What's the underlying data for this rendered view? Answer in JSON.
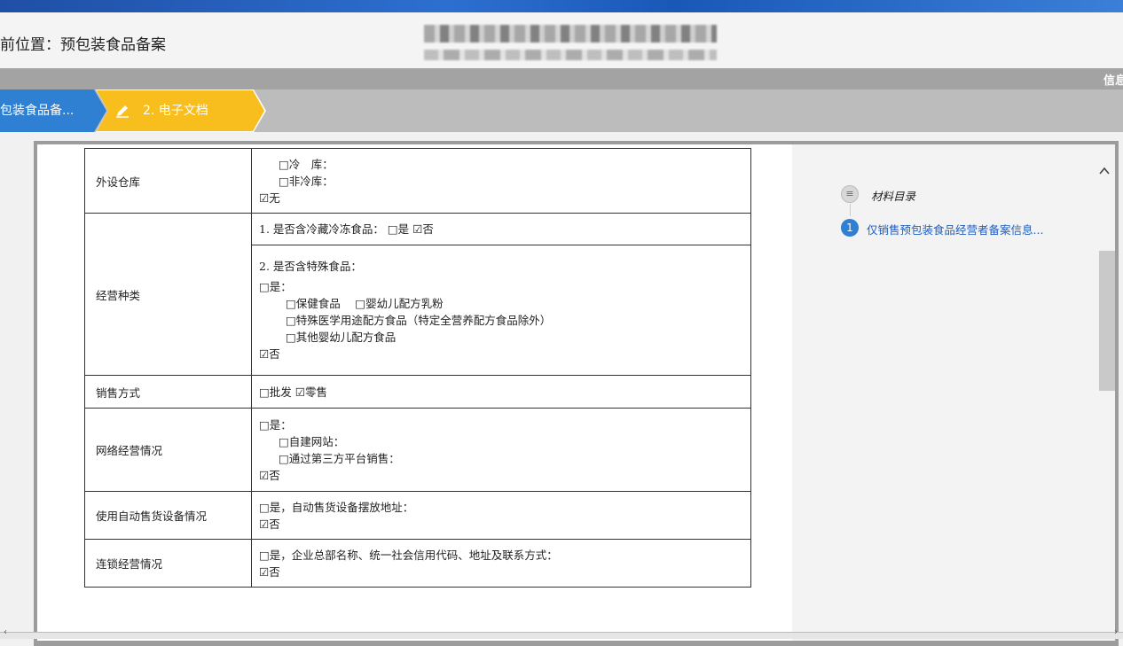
{
  "header": {
    "location": "前位置：预包装食品备案",
    "info_label": "信息"
  },
  "steps": [
    {
      "label": "包装食品备..."
    },
    {
      "label": "2. 电子文档",
      "icon": "pencil-icon"
    }
  ],
  "form": {
    "rows": [
      {
        "label": "外设仓库",
        "lines": [
          "□冷　库：",
          "□非冷库：",
          "☑无"
        ]
      },
      {
        "label": "经营种类",
        "sub1": "1. 是否含冷藏冷冻食品：  □是 ☑否",
        "sub2": [
          "2. 是否含特殊食品：",
          "□是：",
          "□保健食品　 □婴幼儿配方乳粉",
          "□特殊医学用途配方食品（特定全营养配方食品除外）",
          "□其他婴幼儿配方食品",
          "☑否"
        ]
      },
      {
        "label": "销售方式",
        "lines": [
          "□批发 ☑零售"
        ]
      },
      {
        "label": "网络经营情况",
        "lines": [
          "□是：",
          "□自建网站：",
          "□通过第三方平台销售：",
          "☑否"
        ]
      },
      {
        "label": "使用自动售货设备情况",
        "lines": [
          "□是，自动售货设备摆放地址：",
          "☑否"
        ]
      },
      {
        "label": "连锁经营情况",
        "lines": [
          "□是，企业总部名称、统一社会信用代码、地址及联系方式：",
          "☑否"
        ]
      }
    ]
  },
  "toc": {
    "title": "材料目录",
    "items": [
      {
        "num": "1",
        "label": "仅销售预包装食品经营者备案信息..."
      }
    ]
  },
  "colors": {
    "step_active": "#f7be1d",
    "step_done": "#2f7fd3",
    "link": "#1f5fbf"
  }
}
